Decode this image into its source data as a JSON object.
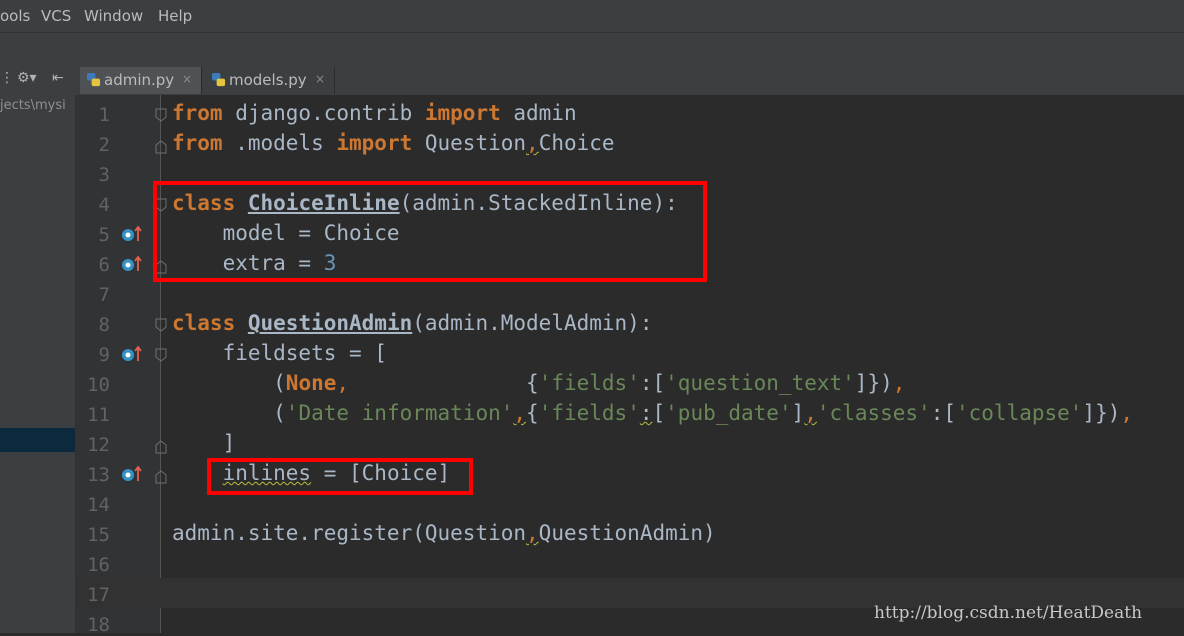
{
  "menu": {
    "items": [
      {
        "label": "ools"
      },
      {
        "label": "VCS"
      },
      {
        "label": "Window"
      },
      {
        "label": "Help"
      }
    ]
  },
  "tabs": [
    {
      "label": "admin.py",
      "close": "×",
      "active": true
    },
    {
      "label": "models.py",
      "close": "×",
      "active": false
    }
  ],
  "project_panel": {
    "path": "jects\\mysi"
  },
  "editor": {
    "line_numbers": [
      "1",
      "2",
      "3",
      "4",
      "5",
      "6",
      "7",
      "8",
      "9",
      "10",
      "11",
      "12",
      "13",
      "14",
      "15",
      "16",
      "17",
      "18"
    ],
    "overridden_marker_lines": [
      5,
      6,
      9,
      13
    ],
    "highlight_boxes": [
      "class ChoiceInline block",
      "inlines = [Choice]"
    ]
  },
  "colors": {
    "keyword": "#cc7832",
    "class_name": "#ffc66d",
    "string": "#6a8759",
    "number": "#6897bb",
    "text": "#a9b7c6",
    "highlight_box": "#ff0000",
    "background": "#2b2b2b"
  },
  "watermark": "http://blog.csdn.net/HeatDeath"
}
